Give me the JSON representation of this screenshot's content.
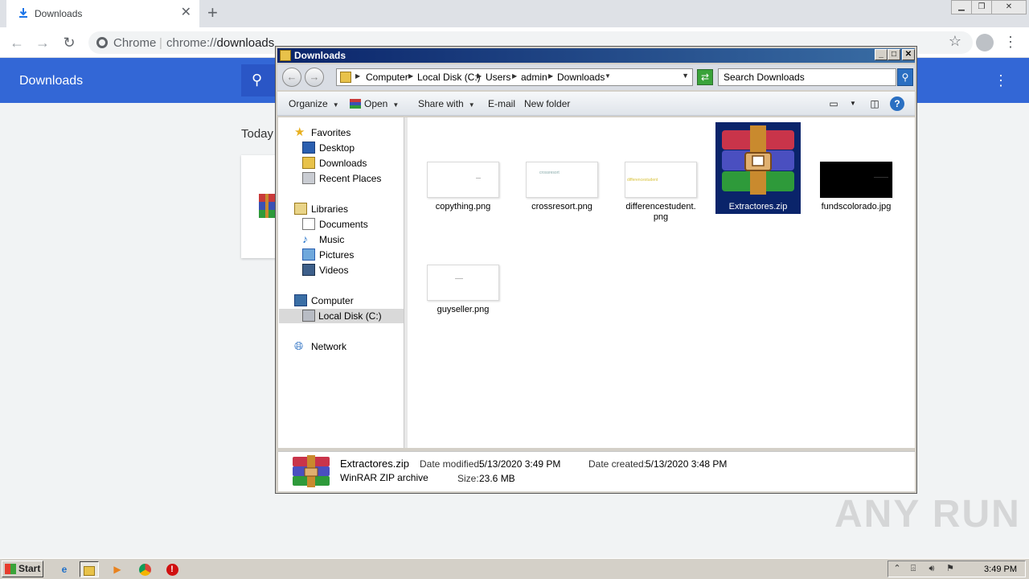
{
  "chrome": {
    "tab_title": "Downloads",
    "omnibox_site": "Chrome",
    "omnibox_scheme": "chrome://",
    "omnibox_path": "downloads",
    "page_title": "Downloads",
    "section_today": "Today"
  },
  "explorer": {
    "title": "Downloads",
    "breadcrumbs": [
      "Computer",
      "Local Disk (C:)",
      "Users",
      "admin",
      "Downloads"
    ],
    "search_placeholder": "Search Downloads",
    "commands": {
      "organize": "Organize",
      "open": "Open",
      "share": "Share with",
      "email": "E-mail",
      "new_folder": "New folder"
    },
    "nav": {
      "favorites": "Favorites",
      "desktop": "Desktop",
      "downloads": "Downloads",
      "recent": "Recent Places",
      "libraries": "Libraries",
      "documents": "Documents",
      "music": "Music",
      "pictures": "Pictures",
      "videos": "Videos",
      "computer": "Computer",
      "local_disk": "Local Disk (C:)",
      "network": "Network"
    },
    "files": [
      {
        "name": "copything.png"
      },
      {
        "name": "crossresort.png",
        "thumb_text": "crossresort"
      },
      {
        "name": "differencestudent.\npng",
        "thumb_text": "differencestudent"
      },
      {
        "name": "Extractores.zip",
        "selected": true
      },
      {
        "name": "fundscolorado.jpg"
      },
      {
        "name": "guyseller.png"
      }
    ],
    "details": {
      "name": "Extractores.zip",
      "type": "WinRAR ZIP archive",
      "modified_label": "Date modified:",
      "modified_value": "5/13/2020 3:49 PM",
      "created_label": "Date created:",
      "created_value": "5/13/2020 3:48 PM",
      "size_label": "Size:",
      "size_value": "23.6 MB"
    }
  },
  "taskbar": {
    "start_label": "Start",
    "clock": "3:49 PM"
  },
  "watermark": "ANY RUN",
  "colors": {
    "chrome_header": "#3367d6",
    "selection": "#0a246a",
    "title_gradient_start": "#0a246a"
  }
}
